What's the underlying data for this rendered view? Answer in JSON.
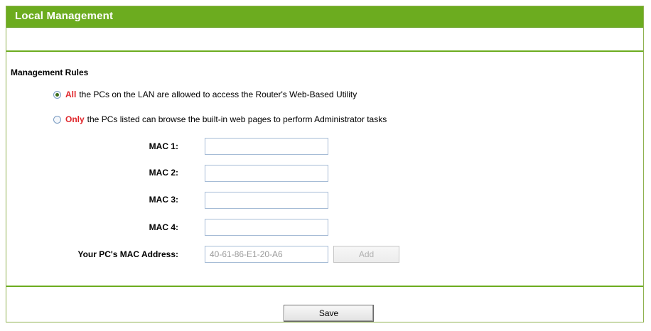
{
  "panel": {
    "title": "Local Management"
  },
  "management_rules": {
    "heading": "Management Rules",
    "options": [
      {
        "prefix": "All",
        "text": "the PCs on the LAN are allowed to access the Router's Web-Based Utility",
        "selected": true
      },
      {
        "prefix": "Only",
        "text": "the PCs listed can browse the built-in web pages to perform Administrator tasks",
        "selected": false
      }
    ]
  },
  "mac_fields": [
    {
      "label": "MAC 1:",
      "value": ""
    },
    {
      "label": "MAC 2:",
      "value": ""
    },
    {
      "label": "MAC 3:",
      "value": ""
    },
    {
      "label": "MAC 4:",
      "value": ""
    }
  ],
  "pc_mac": {
    "label": "Your PC's MAC Address:",
    "value": "40-61-86-E1-20-A6",
    "add_label": "Add"
  },
  "actions": {
    "save_label": "Save"
  },
  "colors": {
    "accent_green": "#6cac1f",
    "highlight_red": "#e0262b"
  }
}
